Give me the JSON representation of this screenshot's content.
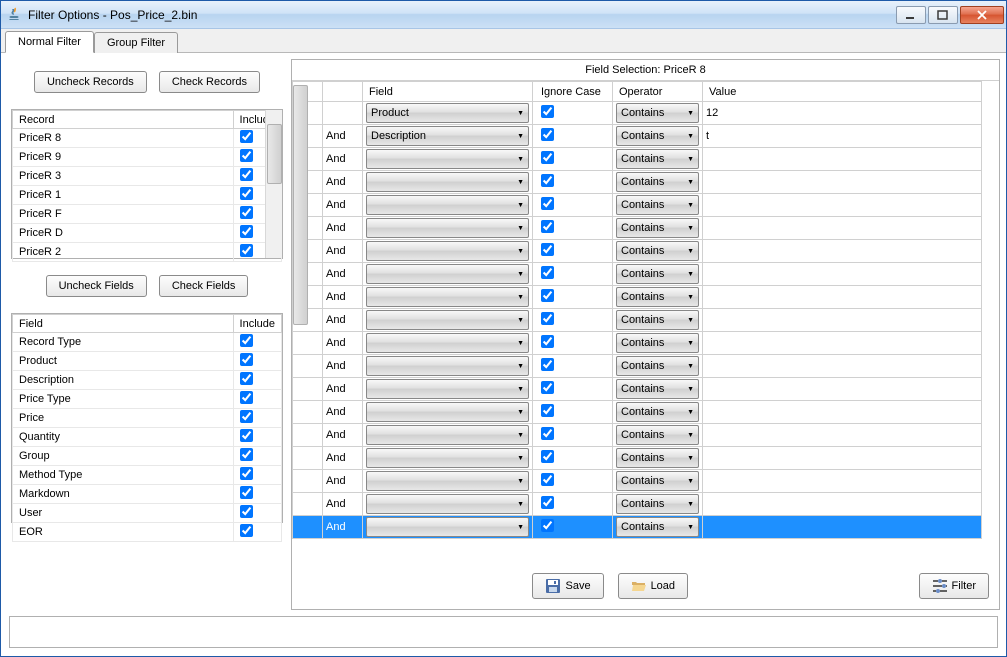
{
  "window": {
    "title": "Filter Options - Pos_Price_2.bin"
  },
  "tabs": [
    {
      "label": "Normal Filter",
      "active": true
    },
    {
      "label": "Group Filter",
      "active": false
    }
  ],
  "buttons": {
    "uncheck_records": "Uncheck Records",
    "check_records": "Check Records",
    "uncheck_fields": "Uncheck Fields",
    "check_fields": "Check Fields",
    "save": "Save",
    "load": "Load",
    "filter": "Filter"
  },
  "records_table": {
    "headers": [
      "Record",
      "Include"
    ],
    "rows": [
      {
        "name": "PriceR 8",
        "checked": true
      },
      {
        "name": "PriceR 9",
        "checked": true
      },
      {
        "name": "PriceR 3",
        "checked": true
      },
      {
        "name": "PriceR 1",
        "checked": true
      },
      {
        "name": "PriceR F",
        "checked": true
      },
      {
        "name": "PriceR D",
        "checked": true
      },
      {
        "name": "PriceR 2",
        "checked": true
      }
    ]
  },
  "fields_table": {
    "headers": [
      "Field",
      "Include"
    ],
    "rows": [
      {
        "name": "Record Type",
        "checked": true
      },
      {
        "name": "Product",
        "checked": true
      },
      {
        "name": "Description",
        "checked": true
      },
      {
        "name": "Price Type",
        "checked": true
      },
      {
        "name": "Price",
        "checked": true
      },
      {
        "name": "Quantity",
        "checked": true
      },
      {
        "name": "Group",
        "checked": true
      },
      {
        "name": "Method Type",
        "checked": true
      },
      {
        "name": "Markdown",
        "checked": true
      },
      {
        "name": "User",
        "checked": true
      },
      {
        "name": "EOR",
        "checked": true
      }
    ]
  },
  "field_selection": {
    "label": "Field Selection: PriceR 8"
  },
  "filter_headers": [
    "",
    "",
    "Field",
    "Ignore Case",
    "Operator",
    "Value"
  ],
  "filter_rows": [
    {
      "andor": "",
      "field": "Product",
      "ignore": true,
      "operator": "Contains",
      "value": "12",
      "selected": false
    },
    {
      "andor": "And",
      "field": "Description",
      "ignore": true,
      "operator": "Contains",
      "value": "t",
      "selected": false
    },
    {
      "andor": "And",
      "field": "",
      "ignore": true,
      "operator": "Contains",
      "value": "",
      "selected": false
    },
    {
      "andor": "And",
      "field": "",
      "ignore": true,
      "operator": "Contains",
      "value": "",
      "selected": false
    },
    {
      "andor": "And",
      "field": "",
      "ignore": true,
      "operator": "Contains",
      "value": "",
      "selected": false
    },
    {
      "andor": "And",
      "field": "",
      "ignore": true,
      "operator": "Contains",
      "value": "",
      "selected": false
    },
    {
      "andor": "And",
      "field": "",
      "ignore": true,
      "operator": "Contains",
      "value": "",
      "selected": false
    },
    {
      "andor": "And",
      "field": "",
      "ignore": true,
      "operator": "Contains",
      "value": "",
      "selected": false
    },
    {
      "andor": "And",
      "field": "",
      "ignore": true,
      "operator": "Contains",
      "value": "",
      "selected": false
    },
    {
      "andor": "And",
      "field": "",
      "ignore": true,
      "operator": "Contains",
      "value": "",
      "selected": false
    },
    {
      "andor": "And",
      "field": "",
      "ignore": true,
      "operator": "Contains",
      "value": "",
      "selected": false
    },
    {
      "andor": "And",
      "field": "",
      "ignore": true,
      "operator": "Contains",
      "value": "",
      "selected": false
    },
    {
      "andor": "And",
      "field": "",
      "ignore": true,
      "operator": "Contains",
      "value": "",
      "selected": false
    },
    {
      "andor": "And",
      "field": "",
      "ignore": true,
      "operator": "Contains",
      "value": "",
      "selected": false
    },
    {
      "andor": "And",
      "field": "",
      "ignore": true,
      "operator": "Contains",
      "value": "",
      "selected": false
    },
    {
      "andor": "And",
      "field": "",
      "ignore": true,
      "operator": "Contains",
      "value": "",
      "selected": false
    },
    {
      "andor": "And",
      "field": "",
      "ignore": true,
      "operator": "Contains",
      "value": "",
      "selected": false
    },
    {
      "andor": "And",
      "field": "",
      "ignore": true,
      "operator": "Contains",
      "value": "",
      "selected": false
    },
    {
      "andor": "And",
      "field": "",
      "ignore": true,
      "operator": "Contains",
      "value": "",
      "selected": true
    }
  ]
}
